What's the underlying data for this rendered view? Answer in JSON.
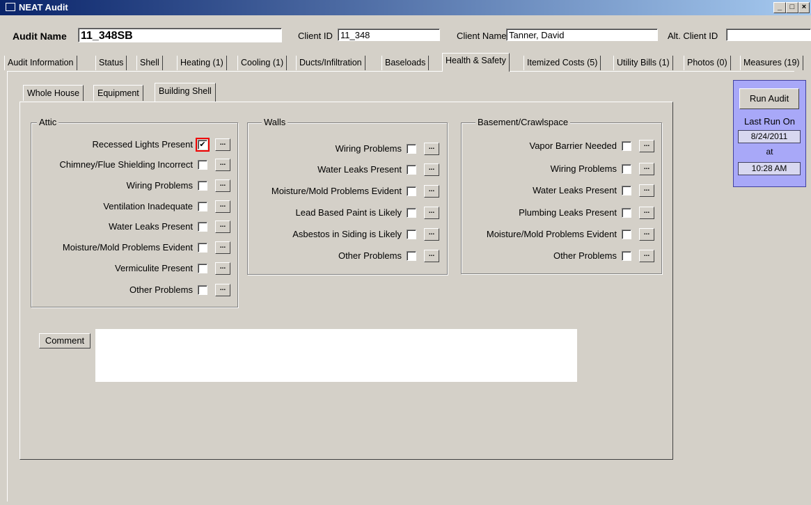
{
  "window": {
    "title": "NEAT Audit",
    "controls": [
      "_",
      "□",
      "×"
    ]
  },
  "header": {
    "audit_name_label": "Audit Name",
    "audit_name_value": "11_348SB",
    "client_id_label": "Client ID",
    "client_id_value": "11_348",
    "client_name_label": "Client Name",
    "client_name_value": "Tanner, David",
    "alt_client_id_label": "Alt. Client ID",
    "alt_client_id_value": ""
  },
  "tabs": [
    {
      "label": "Audit Information"
    },
    {
      "label": "Status"
    },
    {
      "label": "Shell"
    },
    {
      "label": "Heating (1)"
    },
    {
      "label": "Cooling (1)"
    },
    {
      "label": "Ducts/Infiltration"
    },
    {
      "label": "Baseloads"
    },
    {
      "label": "Health & Safety",
      "active": true
    },
    {
      "label": "Itemized Costs (5)"
    },
    {
      "label": "Utility Bills (1)"
    },
    {
      "label": "Photos (0)"
    },
    {
      "label": "Measures (19)"
    }
  ],
  "subtabs": [
    {
      "label": "Whole House"
    },
    {
      "label": "Equipment"
    },
    {
      "label": "Building Shell",
      "active": true
    }
  ],
  "attic": {
    "title": "Attic",
    "items": [
      {
        "label": "Recessed Lights Present",
        "checked": true
      },
      {
        "label": "Chimney/Flue Shielding Incorrect",
        "checked": false
      },
      {
        "label": "Wiring Problems",
        "checked": false
      },
      {
        "label": "Ventilation Inadequate",
        "checked": false
      },
      {
        "label": "Water Leaks Present",
        "checked": false
      },
      {
        "label": "Moisture/Mold Problems Evident",
        "checked": false
      },
      {
        "label": "Vermiculite Present",
        "checked": false
      },
      {
        "label": "Other Problems",
        "checked": false
      }
    ]
  },
  "walls": {
    "title": "Walls",
    "items": [
      {
        "label": "Wiring Problems",
        "checked": false
      },
      {
        "label": "Water Leaks Present",
        "checked": false
      },
      {
        "label": "Moisture/Mold Problems Evident",
        "checked": false
      },
      {
        "label": "Lead Based Paint is Likely",
        "checked": false
      },
      {
        "label": "Asbestos in Siding is Likely",
        "checked": false
      },
      {
        "label": "Other Problems",
        "checked": false
      }
    ]
  },
  "basement": {
    "title": "Basement/Crawlspace",
    "items": [
      {
        "label": "Vapor Barrier Needed",
        "checked": false
      },
      {
        "label": "Wiring Problems",
        "checked": false
      },
      {
        "label": "Water Leaks Present",
        "checked": false
      },
      {
        "label": "Plumbing Leaks Present",
        "checked": false
      },
      {
        "label": "Moisture/Mold Problems Evident",
        "checked": false
      },
      {
        "label": "Other Problems",
        "checked": false
      }
    ]
  },
  "ellipsis_label": "...",
  "comment": {
    "button_label": "Comment",
    "value": ""
  },
  "run_audit": {
    "button_label": "Run Audit",
    "last_run_label": "Last Run On",
    "date": "8/24/2011",
    "at_label": "at",
    "time": "10:28 AM"
  },
  "colors": {
    "titlebar": "#0a246a",
    "run_panel": "#a8a8f8",
    "highlight": "#e00000"
  }
}
